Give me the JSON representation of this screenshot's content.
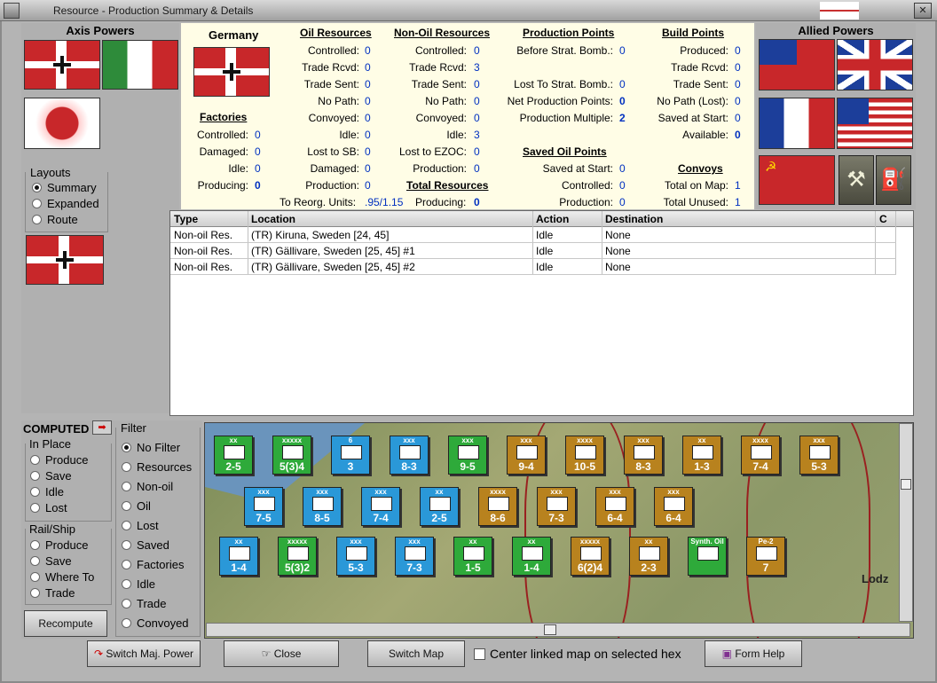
{
  "window": {
    "title": "Resource - Production Summary & Details"
  },
  "left_panel": {
    "header": "Axis Powers",
    "layouts": {
      "legend": "Layouts",
      "options": [
        "Summary",
        "Expanded",
        "Route"
      ],
      "selected": "Summary"
    }
  },
  "right_panel": {
    "header": "Allied Powers"
  },
  "summary": {
    "country": "Germany",
    "factories": {
      "title": "Factories",
      "rows": [
        [
          "Controlled:",
          "0"
        ],
        [
          "Damaged:",
          "0"
        ],
        [
          "Idle:",
          "0"
        ],
        [
          "Producing:",
          "0"
        ]
      ]
    },
    "oil": {
      "title": "Oil Resources",
      "rows": [
        [
          "Controlled:",
          "0"
        ],
        [
          "Trade Rcvd:",
          "0"
        ],
        [
          "Trade Sent:",
          "0"
        ],
        [
          "No Path:",
          "0"
        ],
        [
          "Convoyed:",
          "0"
        ],
        [
          "Idle:",
          "0"
        ],
        [
          "Lost to SB:",
          "0"
        ],
        [
          "Damaged:",
          "0"
        ],
        [
          "Production:",
          "0"
        ]
      ]
    },
    "reorg": {
      "label": "To Reorg. Units:",
      "value": ".95/1.15"
    },
    "nonoil": {
      "title": "Non-Oil Resources",
      "rows": [
        [
          "Controlled:",
          "0"
        ],
        [
          "Trade Rcvd:",
          "3"
        ],
        [
          "Trade Sent:",
          "0"
        ],
        [
          "No Path:",
          "0"
        ],
        [
          "Convoyed:",
          "0"
        ],
        [
          "Idle:",
          "3"
        ],
        [
          "Lost to EZOC:",
          "0"
        ],
        [
          "Production:",
          "0"
        ]
      ]
    },
    "total": {
      "title": "Total Resources",
      "label": "Producing:",
      "value": "0"
    },
    "pp": {
      "title": "Production Points",
      "rows": [
        [
          "Before Strat. Bomb.:",
          "0"
        ],
        [
          "Lost To Strat. Bomb.:",
          "0"
        ],
        [
          "Net Production Points:",
          "0"
        ],
        [
          "Production Multiple:",
          "2"
        ]
      ]
    },
    "saved_oil": {
      "title": "Saved Oil Points",
      "rows": [
        [
          "Saved at Start:",
          "0"
        ],
        [
          "Controlled:",
          "0"
        ],
        [
          "Production:",
          "0"
        ]
      ]
    },
    "bp": {
      "title": "Build Points",
      "rows": [
        [
          "Produced:",
          "0"
        ],
        [
          "Trade Rcvd:",
          "0"
        ],
        [
          "Trade Sent:",
          "0"
        ],
        [
          "No Path (Lost):",
          "0"
        ],
        [
          "Saved at Start:",
          "0"
        ],
        [
          "Available:",
          "0"
        ]
      ]
    },
    "convoys": {
      "title": "Convoys",
      "rows": [
        [
          "Total on Map:",
          "1"
        ],
        [
          "Total Unused:",
          "1"
        ]
      ]
    }
  },
  "table": {
    "columns": [
      "Type",
      "Location",
      "Action",
      "Destination",
      "C"
    ],
    "rows": [
      [
        "Non-oil Res.",
        "(TR) Kiruna, Sweden [24, 45]",
        "Idle",
        "None"
      ],
      [
        "Non-oil Res.",
        "(TR) Gällivare, Sweden [25, 45] #1",
        "Idle",
        "None"
      ],
      [
        "Non-oil Res.",
        "(TR) Gällivare, Sweden [25, 45] #2",
        "Idle",
        "None"
      ]
    ]
  },
  "computed": {
    "label": "COMPUTED",
    "in_place": {
      "legend": "In Place",
      "options": [
        "Produce",
        "Save",
        "Idle",
        "Lost"
      ]
    },
    "rail_ship": {
      "legend": "Rail/Ship",
      "options": [
        "Produce",
        "Save",
        "Where To",
        "Trade"
      ]
    },
    "recompute": "Recompute"
  },
  "filter": {
    "legend": "Filter",
    "options": [
      "No Filter",
      "Resources",
      "Non-oil",
      "Oil",
      "Lost",
      "Saved",
      "Factories",
      "Idle",
      "Trade",
      "Convoyed"
    ],
    "selected": "No Filter"
  },
  "map": {
    "cities": [
      "Lodz"
    ],
    "counters": [
      {
        "c": "g",
        "st": "2-5",
        "sz": "xx"
      },
      {
        "c": "g",
        "st": "5(3)4",
        "sz": "xxxxx"
      },
      {
        "c": "b",
        "st": "3",
        "sz": "6"
      },
      {
        "c": "b",
        "st": "8-3",
        "sz": "xxx"
      },
      {
        "c": "g",
        "st": "9-5",
        "sz": "xxx"
      },
      {
        "c": "o",
        "st": "9-4",
        "sz": "xxx"
      },
      {
        "c": "o",
        "st": "10-5",
        "sz": "xxxx"
      },
      {
        "c": "o",
        "st": "8-3",
        "sz": "xxx"
      },
      {
        "c": "o",
        "st": "1-3",
        "sz": "xx"
      },
      {
        "c": "o",
        "st": "7-4",
        "sz": "xxxx"
      },
      {
        "c": "o",
        "st": "5-3",
        "sz": "xxx"
      },
      {
        "c": "b",
        "st": "7-5",
        "sz": "xxx"
      },
      {
        "c": "b",
        "st": "8-5",
        "sz": "xxx"
      },
      {
        "c": "b",
        "st": "7-4",
        "sz": "xxx"
      },
      {
        "c": "b",
        "st": "2-5",
        "sz": "xx"
      },
      {
        "c": "o",
        "st": "8-6",
        "sz": "xxxx"
      },
      {
        "c": "o",
        "st": "7-3",
        "sz": "xxx"
      },
      {
        "c": "o",
        "st": "6-4",
        "sz": "xxx"
      },
      {
        "c": "o",
        "st": "6-4",
        "sz": "xxx"
      },
      {
        "c": "b",
        "st": "1-4",
        "sz": "xx"
      },
      {
        "c": "g",
        "st": "5(3)2",
        "sz": "xxxxx"
      },
      {
        "c": "b",
        "st": "5-3",
        "sz": "xxx"
      },
      {
        "c": "b",
        "st": "7-3",
        "sz": "xxx"
      },
      {
        "c": "g",
        "st": "1-5",
        "sz": "xx"
      },
      {
        "c": "g",
        "st": "1-4",
        "sz": "xx"
      },
      {
        "c": "o",
        "st": "6(2)4",
        "sz": "xxxxx"
      },
      {
        "c": "o",
        "st": "2-3",
        "sz": "xx"
      },
      {
        "c": "g",
        "st": "",
        "sz": "Synth. Oil"
      },
      {
        "c": "o",
        "st": "7",
        "sz": "Pe-2"
      }
    ]
  },
  "buttons": {
    "switch_power": "Switch Maj. Power",
    "close": "Close",
    "switch_map": "Switch Map",
    "center_link": "Center linked map on selected hex",
    "form_help": "Form Help"
  }
}
